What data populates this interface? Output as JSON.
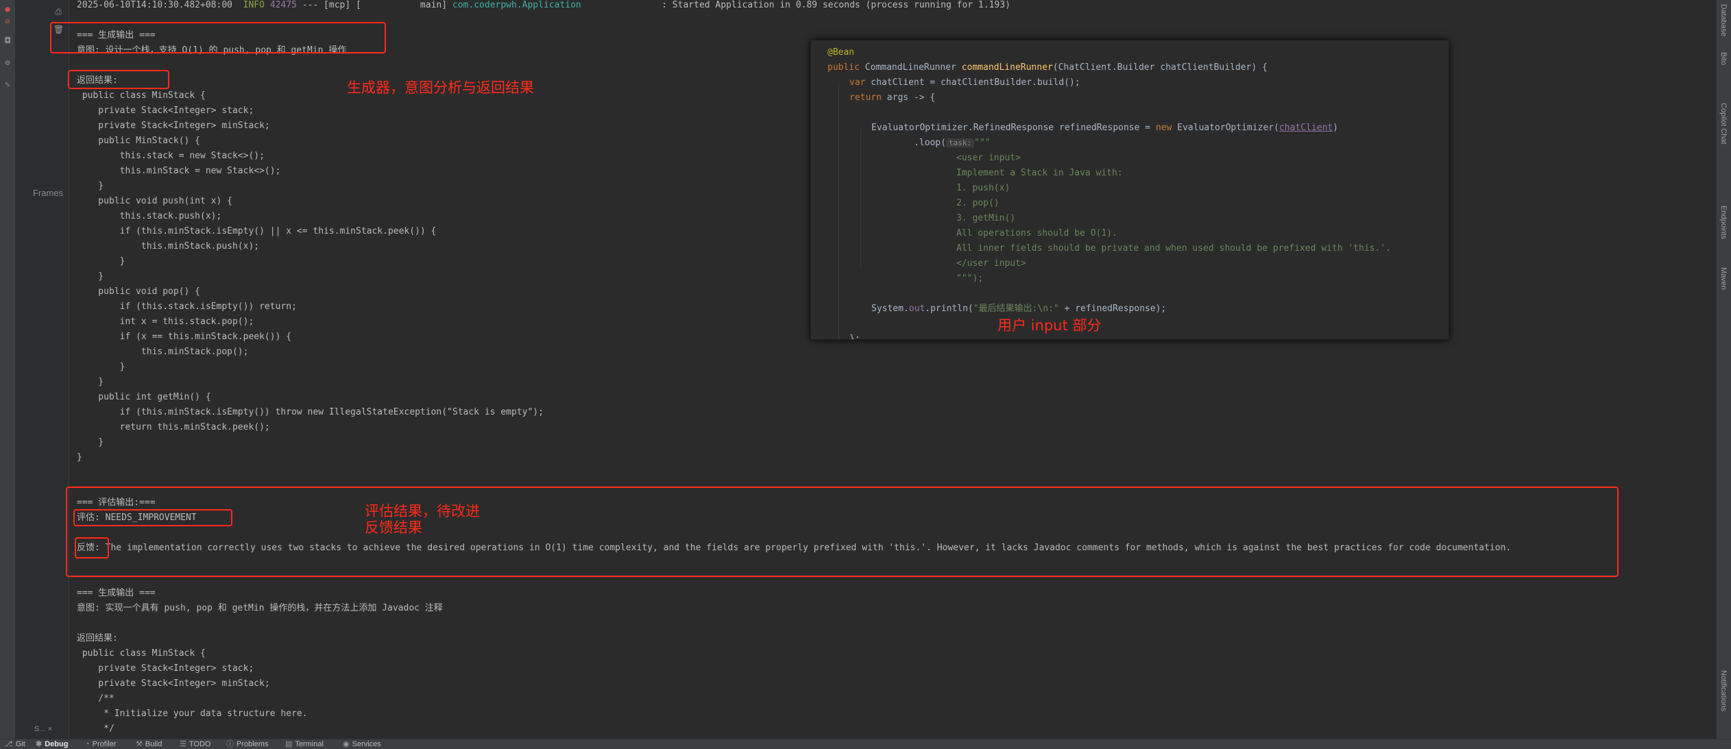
{
  "console": {
    "log_timestamp": "2025-06-10T14:10:30.482+08:00",
    "log_level": "INFO",
    "log_pid": "42475",
    "log_mid": "--- [mcp] [           main]",
    "log_class": "com.coderpwh.Application",
    "log_message": ": Started Application in 0.89 seconds (process running for 1.193)",
    "lines": {
      "gen_header": "=== 生成输出 ===",
      "intent": "意图: 设计一个栈，支持 O(1) 的 push, pop 和 getMin 操作",
      "result_label": "返回结果:",
      "c1": " public class MinStack {",
      "c2": "    private Stack<Integer> stack;",
      "c3": "    private Stack<Integer> minStack;",
      "c4": "    public MinStack() {",
      "c5": "        this.stack = new Stack<>();",
      "c6": "        this.minStack = new Stack<>();",
      "c7": "    }",
      "c8": "    public void push(int x) {",
      "c9": "        this.stack.push(x);",
      "c10": "        if (this.minStack.isEmpty() || x <= this.minStack.peek()) {",
      "c11": "            this.minStack.push(x);",
      "c12": "        }",
      "c13": "    }",
      "c14": "    public void pop() {",
      "c15": "        if (this.stack.isEmpty()) return;",
      "c16": "        int x = this.stack.pop();",
      "c17": "        if (x == this.minStack.peek()) {",
      "c18": "            this.minStack.pop();",
      "c19": "        }",
      "c20": "    }",
      "c21": "    public int getMin() {",
      "c22": "        if (this.minStack.isEmpty()) throw new IllegalStateException(\"Stack is empty\");",
      "c23": "        return this.minStack.peek();",
      "c24": "    }",
      "c25": "}",
      "eval_header": "=== 评估输出:===",
      "eval": "评估: NEEDS_IMPROVEMENT",
      "feedback": "反馈: The implementation correctly uses two stacks to achieve the desired operations in O(1) time complexity, and the fields are properly prefixed with 'this.'. However, it lacks Javadoc comments for methods, which is against the best practices for code documentation.",
      "gen_header2": "=== 生成输出 ===",
      "intent2": "意图: 实现一个具有 push, pop 和 getMin 操作的栈，并在方法上添加 Javadoc 注释",
      "result_label2": "返回结果:",
      "d1": " public class MinStack {",
      "d2": "    private Stack<Integer> stack;",
      "d3": "    private Stack<Integer> minStack;",
      "d4": "    /**",
      "d5": "     * Initialize your data structure here.",
      "d6": "     */"
    }
  },
  "annotations": {
    "generator": "生成器，意图分析与返回结果",
    "evaluation_line1": "评估结果，待改进",
    "evaluation_line2": "反馈结果",
    "user_input": "用户 input 部分"
  },
  "snippet": {
    "annotation": "@Bean",
    "public_kw": "public",
    "return_type": "CommandLineRunner",
    "method_name": "commandLineRunner",
    "params": "(ChatClient.Builder chatClientBuilder) {",
    "var_kw": "var",
    "var_stmt": " chatClient = chatClientBuilder.build();",
    "return_kw": "return",
    "lambda": " args -> {",
    "opt_decl": "EvaluatorOptimizer.RefinedResponse refinedResponse = ",
    "new_kw": "new",
    "opt_ctor": " EvaluatorOptimizer(",
    "chat_client_arg": "chatClient",
    "close_paren": ")",
    "loop_call": ".loop(",
    "task_hint": "task:",
    "text_open": "\"\"\"",
    "p1": "<user input>",
    "p2": "Implement a Stack in Java with:",
    "p3": "1. push(x)",
    "p4": "2. pop()",
    "p5": "3. getMin()",
    "p6": "All operations should be O(1).",
    "p7": "All inner fields should be private and when used should be prefixed with 'this.'.",
    "p8": "</user input>",
    "text_close": "\"\"\");",
    "print_a": "System.",
    "print_out": "out",
    "print_b": ".println(",
    "print_str": "\"最后结果输出:\\n:\"",
    "print_c": " + refinedResponse);",
    "closing": "};"
  },
  "sidebar": {
    "frames_label": "Frames",
    "session_tab": "S...",
    "session_close": "×"
  },
  "right_panel": {
    "items": [
      "Database",
      "Bito",
      "Copilot Chat",
      "Endpoints",
      "Maven",
      "Notifications"
    ]
  },
  "status_bar": {
    "git": "Git",
    "debug": "Debug",
    "profiler": "Profiler",
    "build": "Build",
    "todo": "TODO",
    "problems": "Problems",
    "terminal": "Terminal",
    "services": "Services"
  },
  "colors": {
    "highlight_box": "#ff2a1a",
    "background": "#2b2b2b",
    "info_level": "#8ca24b",
    "logger_class": "#3fb0a6"
  },
  "icons": [
    "debug-icon",
    "mute-breakpoints-icon",
    "camera-icon",
    "settings-icon",
    "pin-icon",
    "print-icon",
    "trash-icon",
    "git-icon",
    "debug-tab-icon",
    "profiler-icon",
    "build-icon",
    "todo-icon",
    "problems-icon",
    "terminal-icon",
    "services-icon"
  ]
}
